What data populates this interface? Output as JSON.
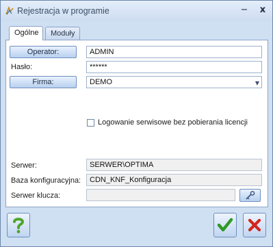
{
  "window": {
    "title": "Rejestracja w programie",
    "minimize_glyph": "−",
    "close_glyph": "x"
  },
  "tabs": [
    {
      "label": "Ogólne",
      "active": true
    },
    {
      "label": "Moduły",
      "active": false
    }
  ],
  "form": {
    "operator_button": "Operator:",
    "operator_value": "ADMIN",
    "password_label": "Hasło:",
    "password_value": "******",
    "company_button": "Firma:",
    "company_value": "DEMO",
    "service_login_label": "Logowanie serwisowe bez pobierania licencji",
    "service_login_checked": false
  },
  "server": {
    "server_label": "Serwer:",
    "server_value": "SERWER\\OPTIMA",
    "config_db_label": "Baza konfiguracyjna:",
    "config_db_value": "CDN_KNF_Konfiguracja",
    "key_server_label": "Serwer klucza:",
    "key_server_value": ""
  },
  "icons": {
    "app": "app-logo-icon",
    "key_lookup": "key-icon",
    "help": "question-mark-icon",
    "ok": "check-icon",
    "cancel": "x-icon"
  },
  "colors": {
    "window_bg": "#cfe0f3",
    "button_gradient_top": "#e8f1fd",
    "button_gradient_bottom": "#b8d0ef",
    "help_green": "#4fa62b",
    "ok_green": "#2f9a24",
    "cancel_red": "#d3261c"
  }
}
